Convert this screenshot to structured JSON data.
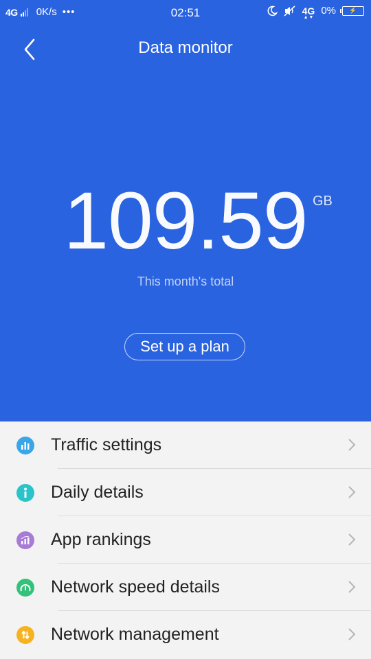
{
  "status_bar": {
    "network": "4G",
    "speed": "0K/s",
    "more": "•••",
    "time": "02:51",
    "network_right": "4G",
    "battery_percent": "0%"
  },
  "header": {
    "title": "Data monitor"
  },
  "usage": {
    "value": "109.59",
    "unit": "GB",
    "caption": "This month's total"
  },
  "plan_button": {
    "label": "Set up a plan"
  },
  "menu": [
    {
      "label": "Traffic settings",
      "icon": "bar-chart-icon",
      "color": "#3aa6e8"
    },
    {
      "label": "Daily details",
      "icon": "info-icon",
      "color": "#29c3c9"
    },
    {
      "label": "App rankings",
      "icon": "ranking-icon",
      "color": "#a77bd6"
    },
    {
      "label": "Network speed details",
      "icon": "speedometer-icon",
      "color": "#34c17a"
    },
    {
      "label": "Network management",
      "icon": "transfer-icon",
      "color": "#f5b321"
    }
  ],
  "colors": {
    "hero_background": "#2a63e0",
    "list_background": "#f3f3f3"
  }
}
